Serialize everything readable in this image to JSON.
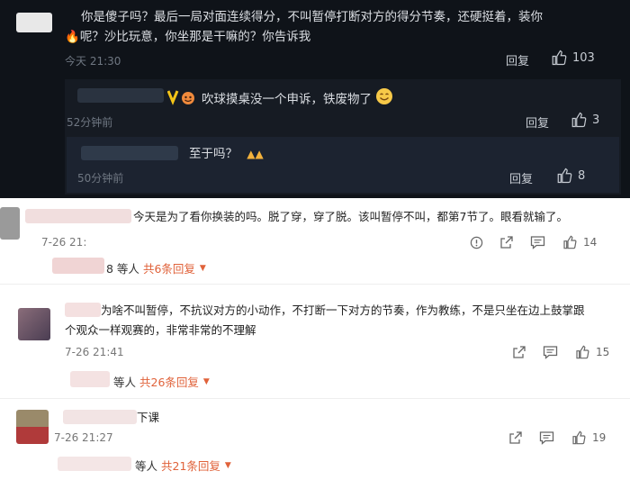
{
  "comments_dark": {
    "c1": {
      "line1": "你是傻子吗？最后一局对面连续得分，不叫暂停打断对方的得分节奏，还硬挺着，装你",
      "line2": "呢？沙比玩意，你坐那是干嘛的？你告诉我",
      "time": "今天 21:30",
      "reply_label": "回复",
      "likes": "103"
    },
    "c2": {
      "text": "吹球摸桌没一个申诉，铁废物了",
      "time": "52分钟前",
      "reply_label": "回复",
      "likes": "3"
    },
    "c3": {
      "text": "至于吗？",
      "time": "50分钟前",
      "reply_label": "回复",
      "likes": "8"
    }
  },
  "comments_light": [
    {
      "text": "今天是为了看你换装的吗。脱了穿，穿了脱。该叫暂停不叫，都第7节了。眼看就输了。",
      "time": "7-26 21:",
      "likes": "14",
      "more_prefix": "8 等人",
      "more_count": "共6条回复"
    },
    {
      "line1": "为啥不叫暂停，不抗议对方的小动作，不打断一下对方的节奏，作为教练，不是只坐在边上鼓掌跟",
      "line2": "个观众一样观赛的，非常非常的不理解",
      "time": "7-26 21:41",
      "likes": "15",
      "more_prefix": "等人",
      "more_count": "共26条回复"
    },
    {
      "text": "下课",
      "time": "7-26 21:27",
      "likes": "19",
      "more_prefix": "等人",
      "more_count": "共21条回复"
    }
  ],
  "colors": {
    "dark_bg": "#0f1319",
    "accent_orange": "#e0623a",
    "vip_gold": "#f5c518"
  }
}
